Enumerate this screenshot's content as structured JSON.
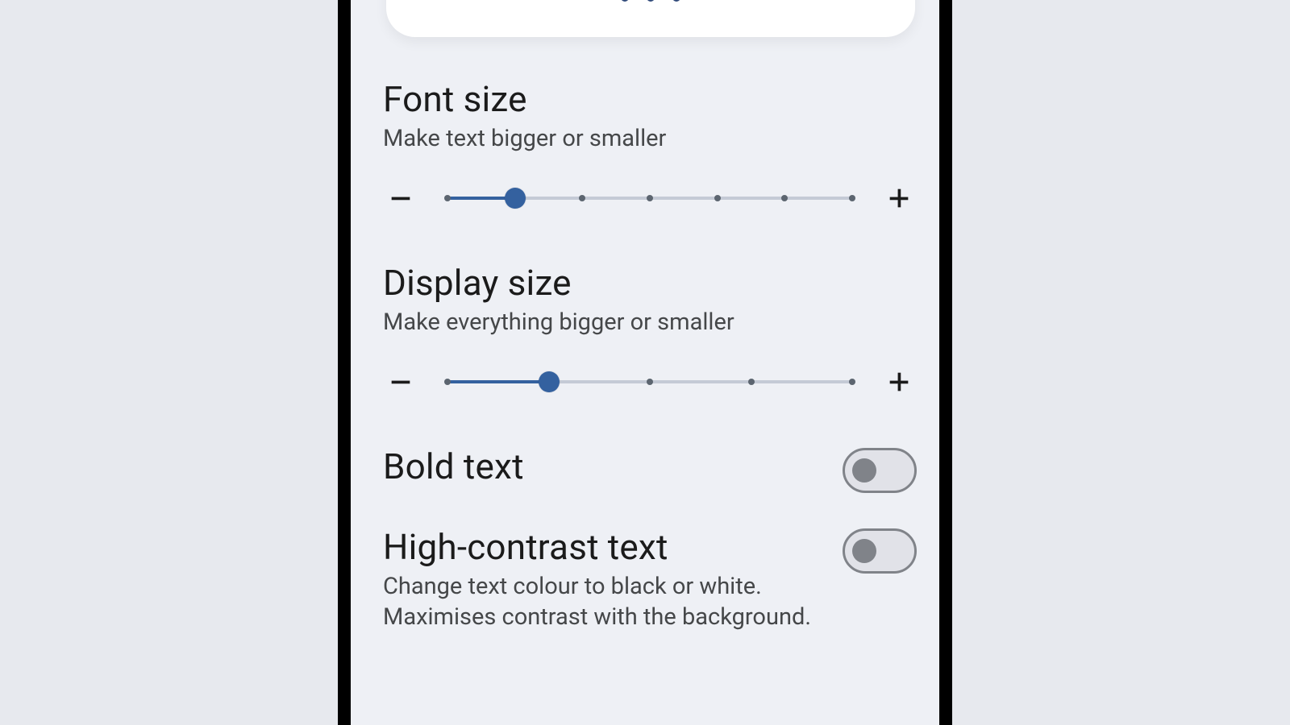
{
  "preview": {
    "dots": 3,
    "active_index": 1
  },
  "font_size": {
    "title": "Font size",
    "subtitle": "Make text bigger or smaller",
    "steps": 7,
    "value_index": 1
  },
  "display_size": {
    "title": "Display size",
    "subtitle": "Make everything bigger or smaller",
    "steps": 5,
    "value_index": 1
  },
  "bold_text": {
    "title": "Bold text",
    "enabled": false
  },
  "high_contrast": {
    "title": "High-contrast text",
    "subtitle": "Change text colour to black or white. Maximises contrast with the background.",
    "enabled": false
  },
  "colors": {
    "accent": "#34619f"
  }
}
